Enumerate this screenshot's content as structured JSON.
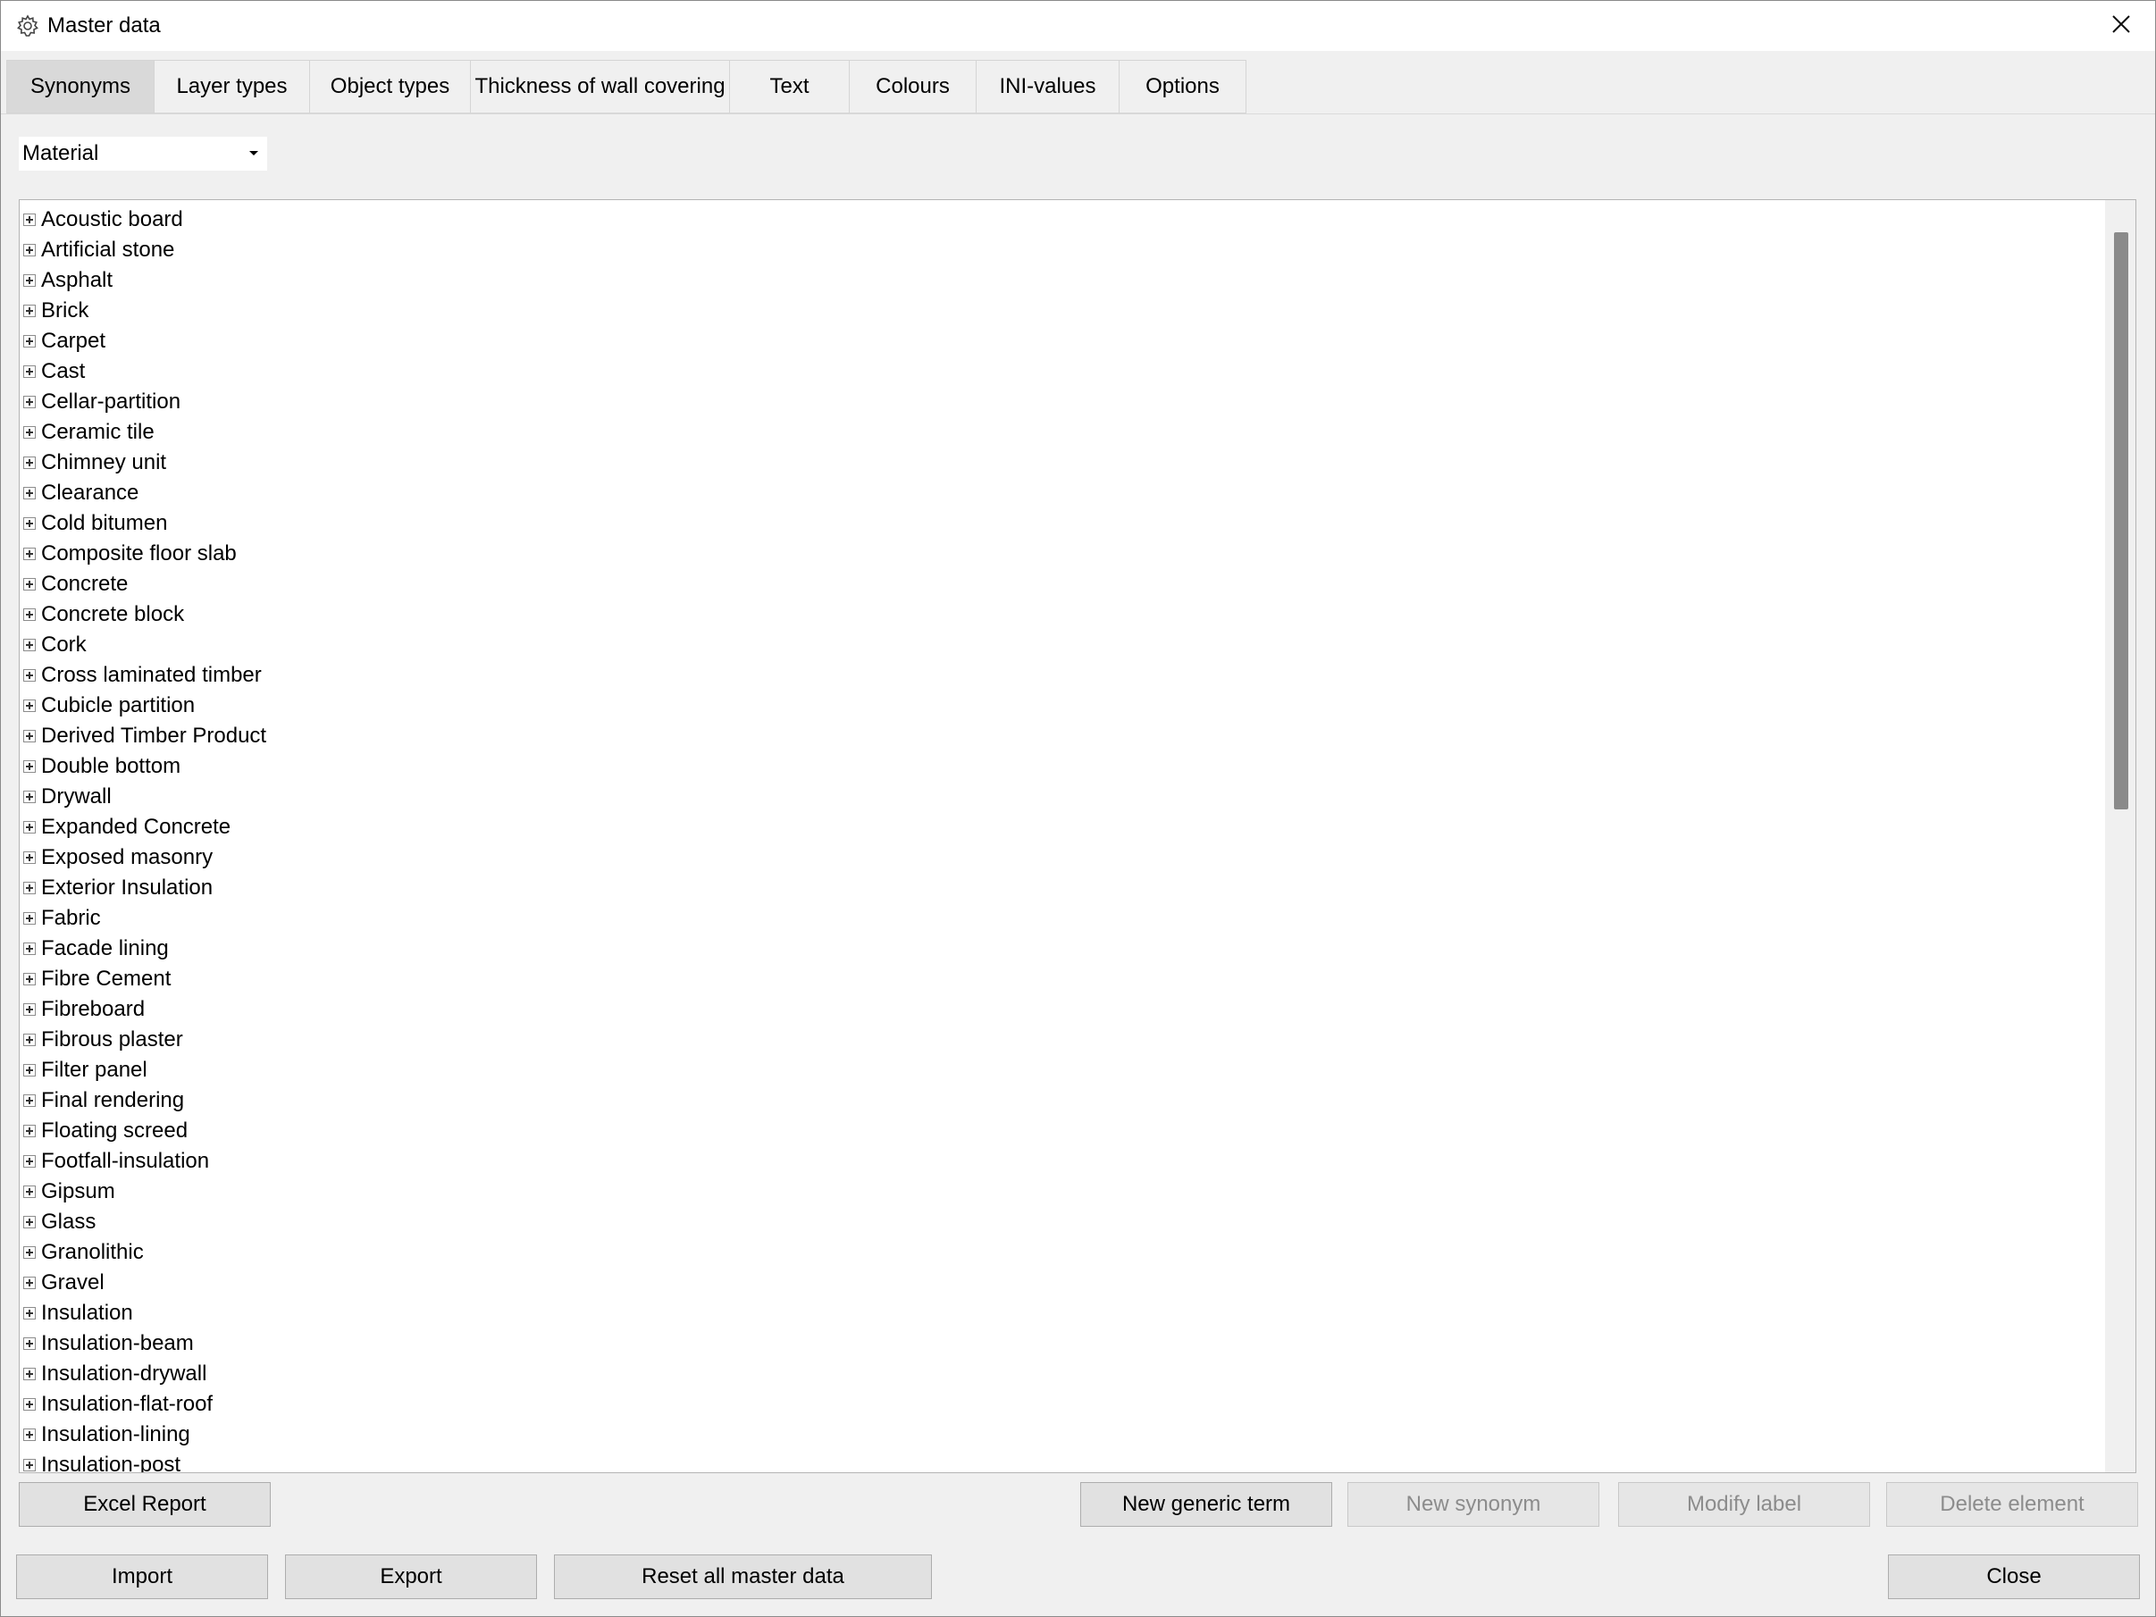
{
  "window": {
    "title": "Master data"
  },
  "tabs": [
    {
      "label": "Synonyms",
      "active": true
    },
    {
      "label": "Layer types",
      "active": false
    },
    {
      "label": "Object types",
      "active": false
    },
    {
      "label": "Thickness of wall covering",
      "active": false
    },
    {
      "label": "Text",
      "active": false
    },
    {
      "label": "Colours",
      "active": false
    },
    {
      "label": "INI-values",
      "active": false
    },
    {
      "label": "Options",
      "active": false
    }
  ],
  "category_select": {
    "value": "Material"
  },
  "tree": {
    "items": [
      "Acoustic board",
      "Artificial stone",
      "Asphalt",
      "Brick",
      "Carpet",
      "Cast",
      "Cellar-partition",
      "Ceramic tile",
      "Chimney unit",
      "Clearance",
      "Cold bitumen",
      "Composite floor slab",
      "Concrete",
      "Concrete block",
      "Cork",
      "Cross laminated timber",
      "Cubicle partition",
      "Derived Timber Product",
      "Double bottom",
      "Drywall",
      "Expanded Concrete",
      "Exposed masonry",
      "Exterior Insulation",
      "Fabric",
      "Facade lining",
      "Fibre Cement",
      "Fibreboard",
      "Fibrous plaster",
      "Filter panel",
      "Final rendering",
      "Floating screed",
      "Footfall-insulation",
      "Gipsum",
      "Glass",
      "Granolithic",
      "Gravel",
      "Insulation",
      "Insulation-beam",
      "Insulation-drywall",
      "Insulation-flat-roof",
      "Insulation-lining",
      "Insulation-post"
    ]
  },
  "buttons": {
    "excel_report": "Excel Report",
    "new_generic_term": "New generic term",
    "new_synonym": "New synonym",
    "modify_label": "Modify label",
    "delete_element": "Delete element",
    "import": "Import",
    "export": "Export",
    "reset_all": "Reset all master data",
    "close": "Close"
  },
  "icons": {
    "title": "gear-icon",
    "close": "close-icon",
    "dropdown": "chevron-down-icon",
    "expander": "plus-box-icon"
  },
  "colors": {
    "background": "#f0f0f0",
    "active_tab": "#d9d9d9",
    "disabled_text": "#8c8c8c",
    "scroll_thumb": "#8a8a8a"
  }
}
